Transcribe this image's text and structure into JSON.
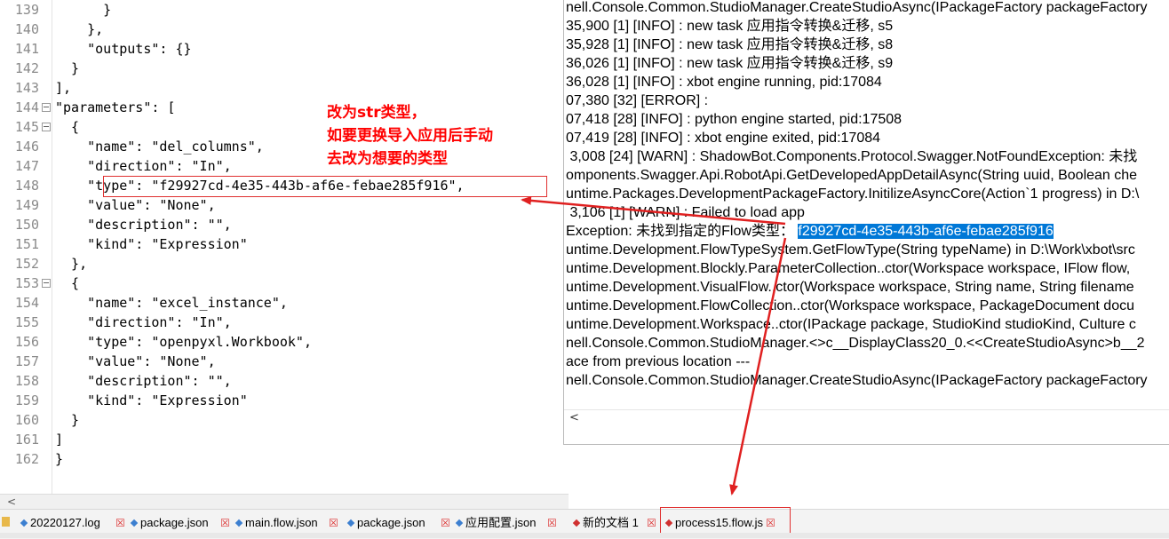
{
  "editor": {
    "lines": [
      {
        "num": "139",
        "code": "      }",
        "fold": false
      },
      {
        "num": "140",
        "code": "    },",
        "fold": false
      },
      {
        "num": "141",
        "code": "    \"outputs\": {}",
        "fold": false
      },
      {
        "num": "142",
        "code": "  }",
        "fold": false
      },
      {
        "num": "143",
        "code": "],",
        "fold": false
      },
      {
        "num": "144",
        "code": "\"parameters\": [",
        "fold": true
      },
      {
        "num": "145",
        "code": "  {",
        "fold": true
      },
      {
        "num": "146",
        "code": "    \"name\": \"del_columns\",",
        "fold": false
      },
      {
        "num": "147",
        "code": "    \"direction\": \"In\",",
        "fold": false
      },
      {
        "num": "148",
        "code": "    \"type\": \"f29927cd-4e35-443b-af6e-febae285f916\",",
        "fold": false
      },
      {
        "num": "149",
        "code": "    \"value\": \"None\",",
        "fold": false
      },
      {
        "num": "150",
        "code": "    \"description\": \"\",",
        "fold": false
      },
      {
        "num": "151",
        "code": "    \"kind\": \"Expression\"",
        "fold": false
      },
      {
        "num": "152",
        "code": "  },",
        "fold": false
      },
      {
        "num": "153",
        "code": "  {",
        "fold": true
      },
      {
        "num": "154",
        "code": "    \"name\": \"excel_instance\",",
        "fold": false
      },
      {
        "num": "155",
        "code": "    \"direction\": \"In\",",
        "fold": false
      },
      {
        "num": "156",
        "code": "    \"type\": \"openpyxl.Workbook\",",
        "fold": false
      },
      {
        "num": "157",
        "code": "    \"value\": \"None\",",
        "fold": false
      },
      {
        "num": "158",
        "code": "    \"description\": \"\",",
        "fold": false
      },
      {
        "num": "159",
        "code": "    \"kind\": \"Expression\"",
        "fold": false
      },
      {
        "num": "160",
        "code": "  }",
        "fold": false
      },
      {
        "num": "161",
        "code": "]",
        "fold": false
      },
      {
        "num": "162",
        "code": "}",
        "fold": false
      }
    ],
    "scroll_left_arrow": "<"
  },
  "annotation": {
    "lines": [
      "改为str类型，",
      "如要更换导入应用后手动",
      "去改为想要的类型"
    ]
  },
  "console": {
    "lines": [
      {
        "text": "nell.Console.Common.StudioManager.CreateStudioAsync(IPackageFactory packageFactory"
      },
      {
        "text": "35,900 [1] [INFO] : new task 应用指令转换&迁移, s5"
      },
      {
        "text": "35,928 [1] [INFO] : new task 应用指令转换&迁移, s8"
      },
      {
        "text": "36,026 [1] [INFO] : new task 应用指令转换&迁移, s9"
      },
      {
        "text": "36,028 [1] [INFO] : xbot engine running, pid:17084"
      },
      {
        "text": "07,380 [32] [ERROR] :"
      },
      {
        "text": "07,418 [28] [INFO] : python engine started, pid:17508"
      },
      {
        "text": "07,419 [28] [INFO] : xbot engine exited, pid:17084"
      },
      {
        "text": " 3,008 [24] [WARN] : ShadowBot.Components.Protocol.Swagger.NotFoundException: 未找"
      },
      {
        "text": "omponents.Swagger.Api.RobotApi.GetDevelopedAppDetailAsync(String uuid, Boolean che"
      },
      {
        "text": "untime.Packages.DevelopmentPackageFactory.InitilizeAsyncCore(Action`1 progress) in D:\\"
      },
      {
        "text": " 3,106 [1] [WARN] : Failed to load app"
      },
      {
        "text": "Exception: 未找到指定的Flow类型： ",
        "selected": "f29927cd-4e35-443b-af6e-febae285f916"
      },
      {
        "text": "untime.Development.FlowTypeSystem.GetFlowType(String typeName) in D:\\Work\\xbot\\src"
      },
      {
        "text": "untime.Development.Blockly.ParameterCollection..ctor(Workspace workspace, IFlow flow,"
      },
      {
        "text": "untime.Development.VisualFlow..ctor(Workspace workspace, String name, String filename"
      },
      {
        "text": "untime.Development.FlowCollection..ctor(Workspace workspace, PackageDocument docu"
      },
      {
        "text": "untime.Development.Workspace..ctor(IPackage package, StudioKind studioKind, Culture c"
      },
      {
        "text": "nell.Console.Common.StudioManager.<>c__DisplayClass20_0.<<CreateStudioAsync>b__2"
      },
      {
        "text": "ace from previous location ---"
      },
      {
        "text": "nell.Console.Common.StudioManager.CreateStudioAsync(IPackageFactory packageFactory"
      }
    ],
    "scroll_left_arrow": "<"
  },
  "tabs": [
    {
      "label": "20220127.log",
      "color": "#3c7fd0"
    },
    {
      "label": "package.json",
      "color": "#3c7fd0"
    },
    {
      "label": "main.flow.json",
      "color": "#3c7fd0"
    },
    {
      "label": "package.json",
      "color": "#3c7fd0"
    },
    {
      "label": "应用配置.json",
      "color": "#3c7fd0"
    },
    {
      "label": "新的文档 1",
      "color": "#d03030"
    },
    {
      "label": "process15.flow.js",
      "color": "#d03030"
    }
  ],
  "tab_close_glyph": "☒",
  "colors": {
    "annotation": "#ff0000",
    "selection": "#0078d7"
  }
}
